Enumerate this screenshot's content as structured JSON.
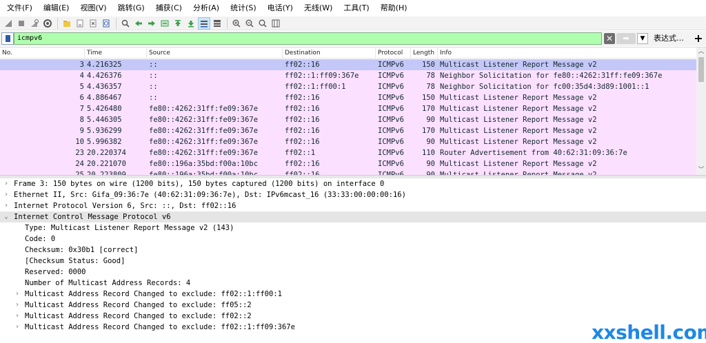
{
  "menu": [
    "文件(F)",
    "编辑(E)",
    "视图(V)",
    "跳转(G)",
    "捕获(C)",
    "分析(A)",
    "统计(S)",
    "电话(Y)",
    "无线(W)",
    "工具(T)",
    "帮助(H)"
  ],
  "toolbar_icons": [
    "shark-fin-start-icon",
    "stop-square-icon",
    "restart-fin-icon",
    "capture-options-gear-icon",
    "open-folder-icon",
    "save-file-icon",
    "close-file-icon",
    "reload-file-icon",
    "find-packet-icon",
    "go-back-icon",
    "go-forward-icon",
    "go-to-packet-icon",
    "go-first-icon",
    "go-last-icon",
    "auto-scroll-icon",
    "colorize-icon",
    "zoom-in-icon",
    "zoom-out-icon",
    "zoom-normal-icon",
    "resize-columns-icon"
  ],
  "filter": {
    "value": "icmpv6",
    "expression_label": "表达式…",
    "add_label": "+",
    "bg_color": "#afffaf"
  },
  "packet_list": {
    "columns": [
      "No.",
      "Time",
      "Source",
      "Destination",
      "Protocol",
      "Length",
      "Info"
    ],
    "rows": [
      {
        "no": "3",
        "time": "4.216325",
        "src": "::",
        "dst": "ff02::16",
        "proto": "ICMPv6",
        "len": "150",
        "info": "Multicast Listener Report Message v2"
      },
      {
        "no": "4",
        "time": "4.426376",
        "src": "::",
        "dst": "ff02::1:ff09:367e",
        "proto": "ICMPv6",
        "len": "78",
        "info": "Neighbor Solicitation for fe80::4262:31ff:fe09:367e"
      },
      {
        "no": "5",
        "time": "4.436357",
        "src": "::",
        "dst": "ff02::1:ff00:1",
        "proto": "ICMPv6",
        "len": "78",
        "info": "Neighbor Solicitation for fc00:35d4:3d89:1001::1"
      },
      {
        "no": "6",
        "time": "4.886467",
        "src": "::",
        "dst": "ff02::16",
        "proto": "ICMPv6",
        "len": "150",
        "info": "Multicast Listener Report Message v2"
      },
      {
        "no": "7",
        "time": "5.426480",
        "src": "fe80::4262:31ff:fe09:367e",
        "dst": "ff02::16",
        "proto": "ICMPv6",
        "len": "170",
        "info": "Multicast Listener Report Message v2"
      },
      {
        "no": "8",
        "time": "5.446305",
        "src": "fe80::4262:31ff:fe09:367e",
        "dst": "ff02::16",
        "proto": "ICMPv6",
        "len": "90",
        "info": "Multicast Listener Report Message v2"
      },
      {
        "no": "9",
        "time": "5.936299",
        "src": "fe80::4262:31ff:fe09:367e",
        "dst": "ff02::16",
        "proto": "ICMPv6",
        "len": "170",
        "info": "Multicast Listener Report Message v2"
      },
      {
        "no": "10",
        "time": "5.996382",
        "src": "fe80::4262:31ff:fe09:367e",
        "dst": "ff02::16",
        "proto": "ICMPv6",
        "len": "90",
        "info": "Multicast Listener Report Message v2"
      },
      {
        "no": "23",
        "time": "20.220374",
        "src": "fe80::4262:31ff:fe09:367e",
        "dst": "ff02::1",
        "proto": "ICMPv6",
        "len": "110",
        "info": "Router Advertisement from 40:62:31:09:36:7e"
      },
      {
        "no": "24",
        "time": "20.221070",
        "src": "fe80::196a:35bd:f00a:10bc",
        "dst": "ff02::16",
        "proto": "ICMPv6",
        "len": "90",
        "info": "Multicast Listener Report Message v2"
      },
      {
        "no": "25",
        "time": "20.223809",
        "src": "fe80::196a:35bd:f00a:10bc",
        "dst": "ff02::16",
        "proto": "ICMPv6",
        "len": "90",
        "info": "Multicast Listener Report Message v2"
      }
    ],
    "selected_no": "3",
    "row_color": "#fce0ff",
    "selected_color": "#c4c8f8"
  },
  "details": [
    {
      "text": "Frame 3: 150 bytes on wire (1200 bits), 150 bytes captured (1200 bits) on interface 0",
      "indent": 0,
      "expander": ">"
    },
    {
      "text": "Ethernet II, Src: Gifa_09:36:7e (40:62:31:09:36:7e), Dst: IPv6mcast_16 (33:33:00:00:00:16)",
      "indent": 0,
      "expander": ">"
    },
    {
      "text": "Internet Protocol Version 6, Src: ::, Dst: ff02::16",
      "indent": 0,
      "expander": ">"
    },
    {
      "text": "Internet Control Message Protocol v6",
      "indent": 0,
      "expander": "v"
    },
    {
      "text": "Type: Multicast Listener Report Message v2 (143)",
      "indent": 1,
      "expander": ""
    },
    {
      "text": "Code: 0",
      "indent": 1,
      "expander": ""
    },
    {
      "text": "Checksum: 0x30b1 [correct]",
      "indent": 1,
      "expander": ""
    },
    {
      "text": "[Checksum Status: Good]",
      "indent": 1,
      "expander": ""
    },
    {
      "text": "Reserved: 0000",
      "indent": 1,
      "expander": ""
    },
    {
      "text": "Number of Multicast Address Records: 4",
      "indent": 1,
      "expander": ""
    },
    {
      "text": "Multicast Address Record Changed to exclude: ff02::1:ff00:1",
      "indent": 1,
      "expander": ">"
    },
    {
      "text": "Multicast Address Record Changed to exclude: ff05::2",
      "indent": 1,
      "expander": ">"
    },
    {
      "text": "Multicast Address Record Changed to exclude: ff02::2",
      "indent": 1,
      "expander": ">"
    },
    {
      "text": "Multicast Address Record Changed to exclude: ff02::1:ff09:367e",
      "indent": 1,
      "expander": ">"
    }
  ],
  "watermark": "xxshell.com"
}
